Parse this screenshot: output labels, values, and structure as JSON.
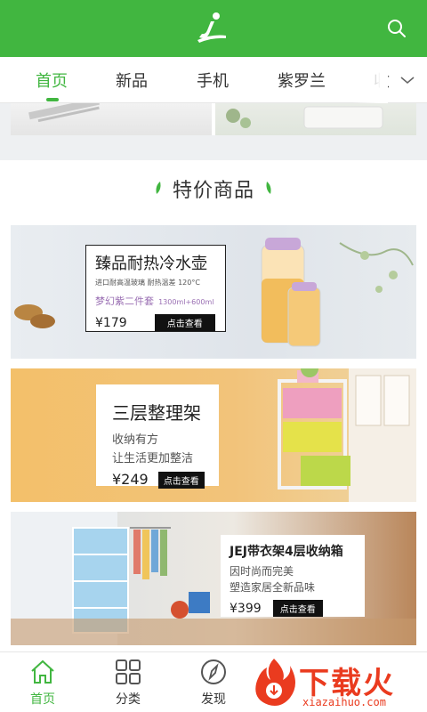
{
  "tabs": [
    {
      "label": "首页",
      "active": true
    },
    {
      "label": "新品"
    },
    {
      "label": "手机"
    },
    {
      "label": "紫罗兰"
    },
    {
      "label": "收"
    }
  ],
  "section": {
    "title": "特价商品"
  },
  "banners": [
    {
      "title": "臻品耐热冷水壶",
      "line1": "进口耐高温玻璃 耐热温差 120°C",
      "line2": "梦幻紫二件套",
      "line2_note": "1300ml+600ml",
      "price": "¥179",
      "cta": "点击查看"
    },
    {
      "title": "三层整理架",
      "line1": "收纳有方",
      "line2": "让生活更加整洁",
      "price": "¥249",
      "cta": "点击查看"
    },
    {
      "title": "JEJ带衣架4层收纳箱",
      "line1": "因时尚而完美",
      "line2": "塑造家居全新品味",
      "price": "¥399",
      "cta": "点击查看"
    }
  ],
  "bottom_nav": [
    {
      "label": "首页",
      "icon": "home-icon",
      "active": true
    },
    {
      "label": "分类",
      "icon": "grid-icon"
    },
    {
      "label": "发现",
      "icon": "compass-icon"
    }
  ],
  "watermark": {
    "text": "下载火",
    "sub": "xiazaihuo.com"
  },
  "colors": {
    "brand": "#41b640",
    "text": "#333333",
    "watermark": "#ea3b1f"
  }
}
